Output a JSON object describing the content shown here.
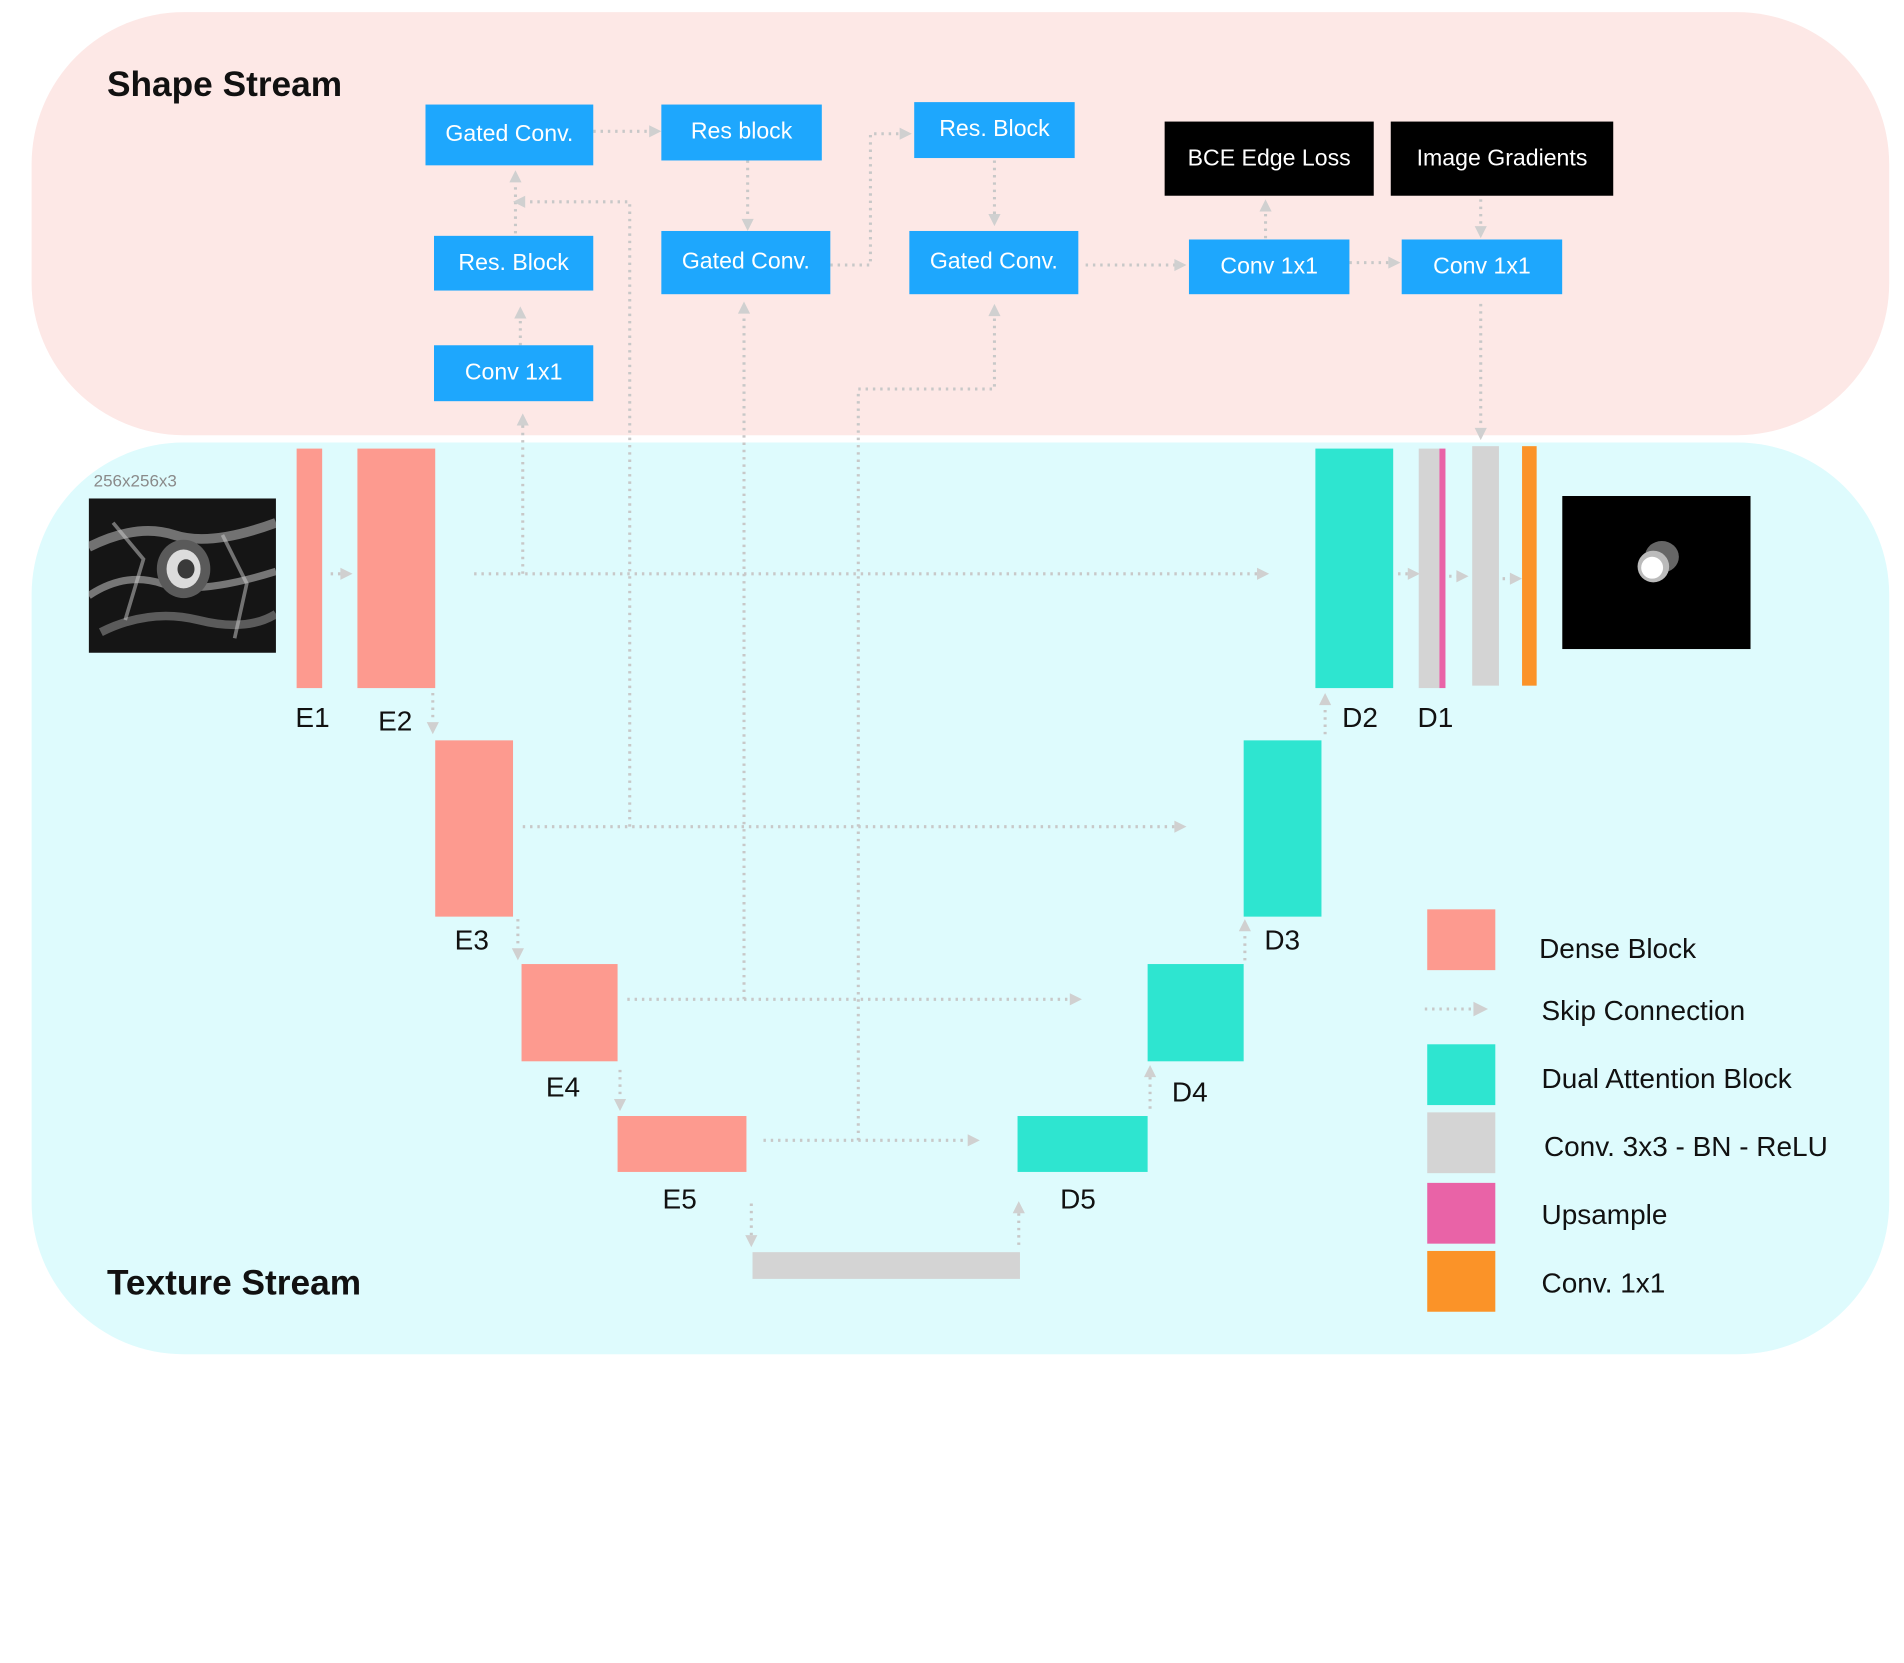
{
  "streams": {
    "shape": "Shape Stream",
    "texture": "Texture Stream"
  },
  "shape_stream": {
    "gated_conv_1": "Gated Conv.",
    "res_block_1": "Res block",
    "res_block_2": "Res. Block",
    "res_block_3": "Res. Block",
    "gated_conv_2": "Gated Conv.",
    "gated_conv_3": "Gated Conv.",
    "conv1x1_1": "Conv 1x1",
    "conv1x1_2": "Conv 1x1",
    "conv1x1_3": "Conv 1x1",
    "bce_edge_loss": "BCE Edge Loss",
    "image_gradients": "Image Gradients"
  },
  "texture_stream": {
    "input_size": "256x256x3",
    "encoders": [
      "E1",
      "E2",
      "E3",
      "E4",
      "E5"
    ],
    "decoders": [
      "D1",
      "D2",
      "D3",
      "D4",
      "D5"
    ]
  },
  "legend": [
    {
      "label": "Dense Block",
      "color": "#fd9a8f"
    },
    {
      "label": "Skip Connection",
      "color": "#c8c8c8"
    },
    {
      "label": "Dual Attention Block",
      "color": "#2ee5d0"
    },
    {
      "label": "Conv. 3x3 - BN - ReLU",
      "color": "#d4d4d4"
    },
    {
      "label": "Upsample",
      "color": "#e963a7"
    },
    {
      "label": "Conv. 1x1",
      "color": "#fb9328"
    }
  ]
}
